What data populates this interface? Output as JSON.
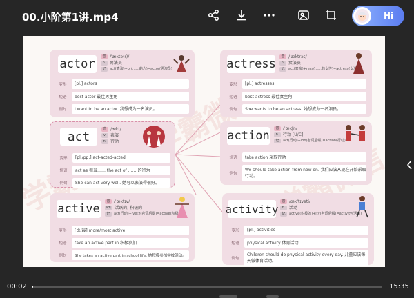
{
  "header": {
    "title": "00.小阶第1讲.mp4",
    "hi_label": "Hi",
    "icons": [
      "share-icon",
      "download-icon",
      "more-icon",
      "screen-cast-icon",
      "crop-icon"
    ]
  },
  "player": {
    "current_time": "00:02",
    "total_time": "15:35",
    "progress": 0.002
  },
  "watermark_text": "学霸微信",
  "cards": {
    "actor": {
      "word": "actor",
      "phonetic": "/ˈæktə(r)/",
      "tag_n": "n.",
      "pos": "男演员",
      "tag_root": "记",
      "formula": "act(表演)+or(……的人)=actor(男演员)",
      "rows": [
        {
          "label": "变形",
          "value": "[pl.] actors"
        },
        {
          "label": "短语",
          "value": "best actor 最佳男主角"
        },
        {
          "label": "例句",
          "value": "I want to be an actor. 我想成为一名演员。"
        }
      ]
    },
    "actress": {
      "word": "actress",
      "phonetic": "/ˈæktrəs/",
      "tag_n": "n.",
      "pos": "女演员",
      "tag_root": "记",
      "formula": "act(表演)+ress(……的女性)=actress(女演员)",
      "rows": [
        {
          "label": "变形",
          "value": "[pl.] actresses"
        },
        {
          "label": "短语",
          "value": "best actress 最佳女主角"
        },
        {
          "label": "例句",
          "value": "She wants to be an actress. 她想成为一名演员。"
        }
      ]
    },
    "act": {
      "word": "act",
      "phonetic": "/ækt/",
      "tag_v": "v.",
      "pos_v": "表演",
      "tag_n": "n.",
      "pos_n": "行动",
      "rows": [
        {
          "label": "变形",
          "value": "[pl./pp.] act-acted-acted"
        },
        {
          "label": "短语",
          "value": "act as 担当……   the act of …… 的行为"
        },
        {
          "label": "例句",
          "value": "She can act very well. 她可以表演得很好。"
        }
      ]
    },
    "action": {
      "word": "action",
      "phonetic": "/ˈækʃn/",
      "tag_n": "n.",
      "pos": "行动 [U/C]",
      "tag_root": "记",
      "formula": "act(行动)+ion(名词后缀)=action(行动)",
      "rows": [
        {
          "label": "短语",
          "value": "take action 采取行动"
        },
        {
          "label": "例句",
          "value": "We should take action from now on. 我们应该从现在开始采取行动。"
        }
      ]
    },
    "active": {
      "word": "active",
      "phonetic": "/ˈæktɪv/",
      "tag_adj": "adj.",
      "pos": "活跃的; 积极的",
      "tag_root": "记",
      "formula": "act(行动)+ive(形容词后缀)=active(积极的)",
      "rows": [
        {
          "label": "变形",
          "value": "[比/最] more/most active"
        },
        {
          "label": "短语",
          "value": "take an active part in 积极参加"
        },
        {
          "label": "例句",
          "value": "She takes an active part in school life. 她积极参加学校活动。"
        }
      ]
    },
    "activity": {
      "word": "activity",
      "phonetic": "/ækˈtɪvəti/",
      "tag_n": "n.",
      "pos": "活动",
      "tag_root": "记",
      "formula": "active(积极的)+ity(名词后缀)=activity(活动)",
      "rows": [
        {
          "label": "变形",
          "value": "[pl.] activities"
        },
        {
          "label": "短语",
          "value": "physical activity 体育活动"
        },
        {
          "label": "例句",
          "value": "Children should do physical activity every day. 儿童应该每天做体育活动。"
        }
      ]
    }
  }
}
